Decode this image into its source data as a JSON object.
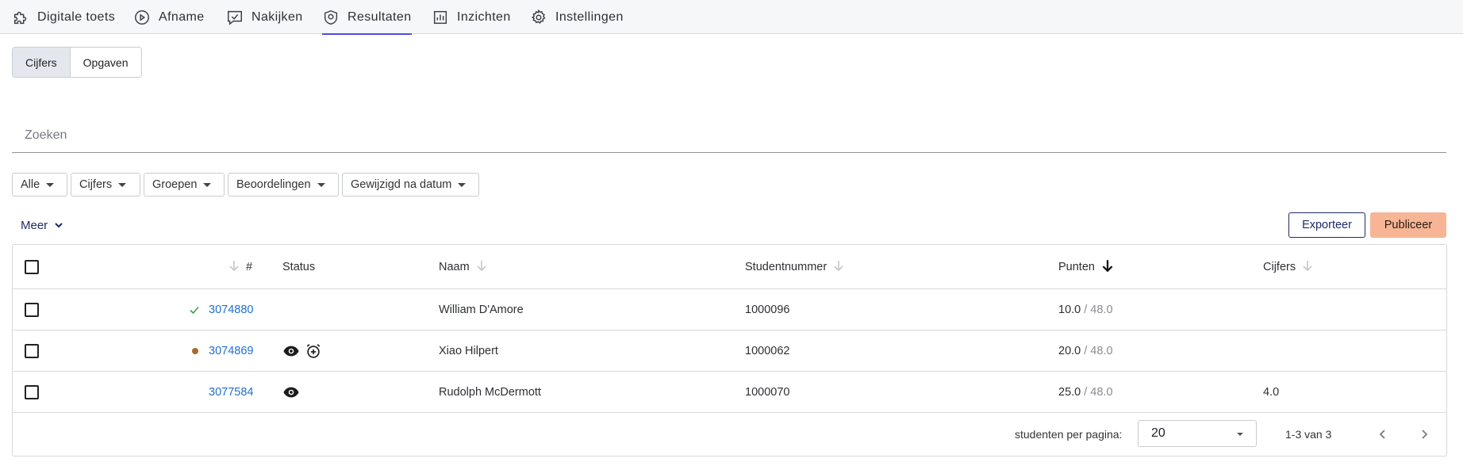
{
  "nav": {
    "items": [
      {
        "label": "Digitale toets",
        "icon": "puzzle-icon"
      },
      {
        "label": "Afname",
        "icon": "play-circle-icon"
      },
      {
        "label": "Nakijken",
        "icon": "chat-check-icon"
      },
      {
        "label": "Resultaten",
        "icon": "shield-icon",
        "active": true
      },
      {
        "label": "Inzichten",
        "icon": "chart-icon"
      },
      {
        "label": "Instellingen",
        "icon": "gear-icon"
      }
    ],
    "active_color": "#4a4de6"
  },
  "tabs": {
    "cijfers": "Cijfers",
    "opgaven": "Opgaven"
  },
  "search": {
    "placeholder": "Zoeken",
    "value": ""
  },
  "filters": {
    "alle": "Alle",
    "cijfers": "Cijfers",
    "groepen": "Groepen",
    "beoordelingen": "Beoordelingen",
    "gewijzigd": "Gewijzigd na datum"
  },
  "meer": "Meer",
  "actions": {
    "export": "Exporteer",
    "publish": "Publiceer",
    "publish_color": "#f7b595"
  },
  "table": {
    "columns": {
      "number": "#",
      "status": "Status",
      "name": "Naam",
      "student_number": "Studentnummer",
      "points": "Punten",
      "grades": "Cijfers"
    },
    "rows": [
      {
        "id": "3074880",
        "status_marker": "check",
        "name": "William D'Amore",
        "student_number": "1000096",
        "points": "10.0",
        "points_max": "/ 48.0",
        "grade": ""
      },
      {
        "id": "3074869",
        "status_marker": "dot",
        "name": "Xiao Hilpert",
        "student_number": "1000062",
        "points": "20.0",
        "points_max": "/ 48.0",
        "grade": ""
      },
      {
        "id": "3077584",
        "status_marker": "",
        "name": "Rudolph McDermott",
        "student_number": "1000070",
        "points": "25.0",
        "points_max": "/ 48.0",
        "grade": "4.0"
      }
    ]
  },
  "pagination": {
    "per_page_label": "studenten per pagina:",
    "per_page_value": "20",
    "range": "1-3 van 3"
  }
}
